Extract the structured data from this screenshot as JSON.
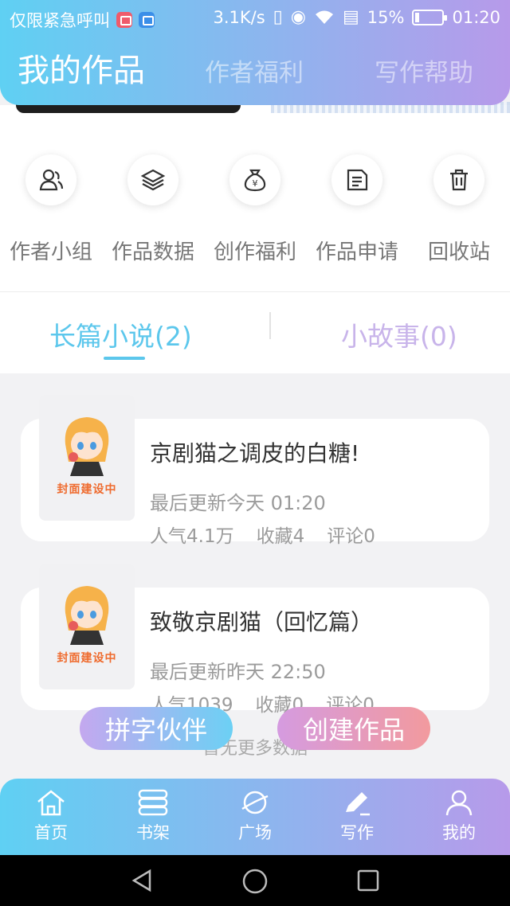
{
  "status_bar": {
    "carrier": "仅限紧急呼叫",
    "speed": "3.1K/s",
    "battery": "15%",
    "battery_level": 0.15,
    "time": "01:20"
  },
  "header": {
    "tabs": [
      "我的作品",
      "作者福利",
      "写作帮助"
    ]
  },
  "quick_actions": [
    {
      "label": "作者小组",
      "icon": "group-icon"
    },
    {
      "label": "作品数据",
      "icon": "layers-icon"
    },
    {
      "label": "创作福利",
      "icon": "money-bag-icon"
    },
    {
      "label": "作品申请",
      "icon": "document-icon"
    },
    {
      "label": "回收站",
      "icon": "trash-icon"
    }
  ],
  "categories": {
    "long": "长篇小说(2)",
    "short": "小故事(0)"
  },
  "works": [
    {
      "cover_text": "封面建设中",
      "title": "京剧猫之调皮的白糖!",
      "update": "最后更新今天 01:20",
      "popularity": "人气4.1万",
      "favorites": "收藏4",
      "comments": "评论0"
    },
    {
      "cover_text": "封面建设中",
      "title": "致敬京剧猫（回忆篇）",
      "update": "最后更新昨天 22:50",
      "popularity": "人气1039",
      "favorites": "收藏0",
      "comments": "评论0"
    }
  ],
  "no_more": "暂无更多数据",
  "buttons": {
    "partner": "拼字伙伴",
    "create": "创建作品"
  },
  "bottom_nav": [
    {
      "label": "首页",
      "icon": "home-icon"
    },
    {
      "label": "书架",
      "icon": "bookshelf-icon"
    },
    {
      "label": "广场",
      "icon": "planet-icon"
    },
    {
      "label": "写作",
      "icon": "pen-icon"
    },
    {
      "label": "我的",
      "icon": "profile-icon"
    }
  ],
  "colors": {
    "accent_blue": "#5cc7ec",
    "accent_purple": "#c8b4ea"
  }
}
